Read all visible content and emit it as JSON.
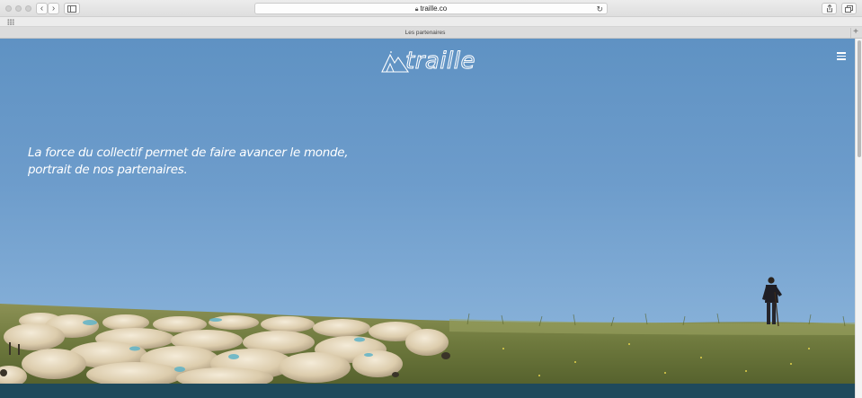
{
  "browser": {
    "address_url": "traille.co",
    "tab_title": "Les partenaires",
    "nav_back": "‹",
    "nav_forward": "›",
    "reload_icon": "↻",
    "new_tab": "+"
  },
  "site": {
    "logo_text": "traille",
    "tagline_line1": "La force du collectif permet de faire avancer le monde,",
    "tagline_line2": "portrait de nos partenaires."
  },
  "colors": {
    "sky": "#6d9ccb",
    "grass": "#6f7a3e",
    "footer_band": "#1f4a5c"
  },
  "icons": [
    "lock-icon",
    "reload-icon",
    "share-icon",
    "tabs-icon",
    "menu-icon",
    "grid-icon",
    "sidebar-icon"
  ]
}
